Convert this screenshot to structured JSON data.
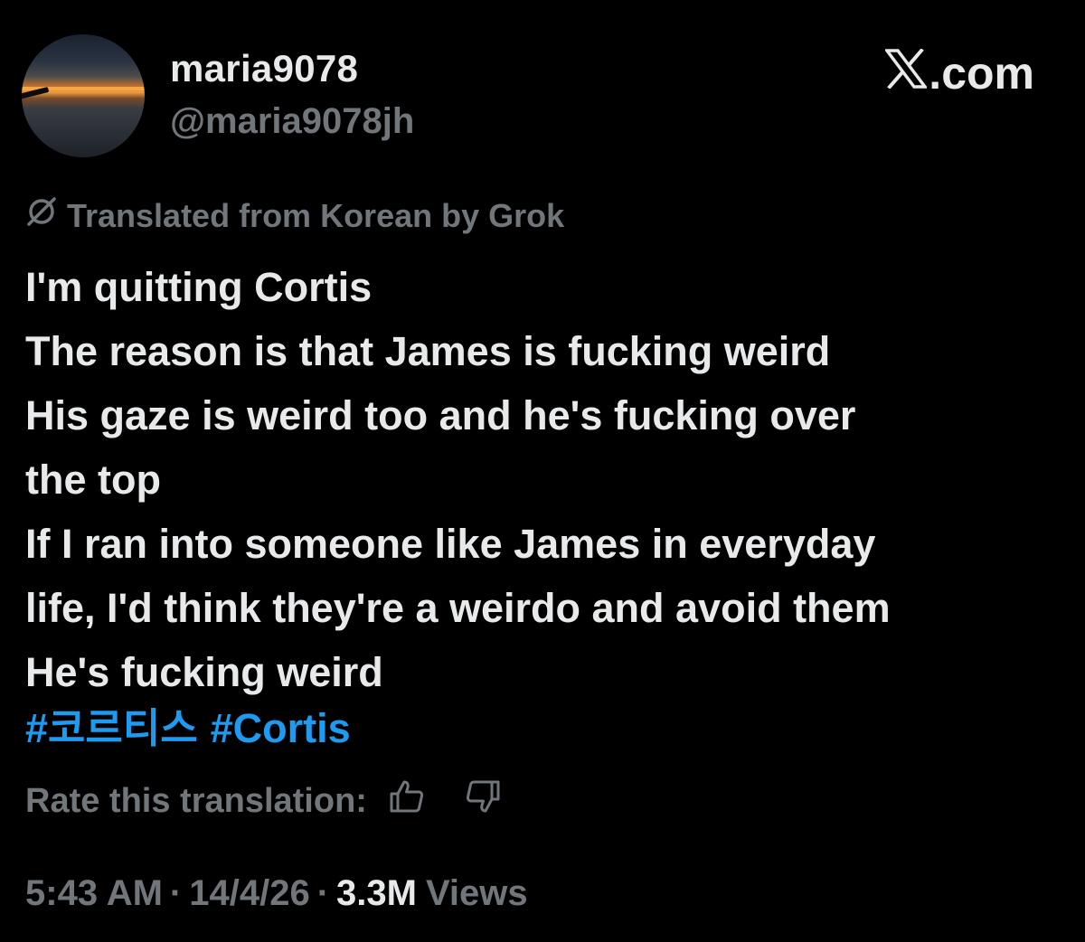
{
  "author": {
    "display_name": "maria9078",
    "handle": "@maria9078jh"
  },
  "brand": {
    "label": ".com"
  },
  "translation_note": "Translated from Korean by Grok",
  "body_lines": [
    "I'm quitting Cortis",
    "The reason is that James is fucking weird",
    "His gaze is weird too and he's fucking over",
    "the top",
    "If I ran into someone like James in everyday",
    "life, I'd think they're a weirdo and avoid them",
    "He's fucking weird"
  ],
  "hashtags": [
    "#코르티스",
    "#Cortis"
  ],
  "rate": {
    "label": "Rate this translation:",
    "thumbs_up_icon": "thumbs-up-icon",
    "thumbs_down_icon": "thumbs-down-icon"
  },
  "meta": {
    "time": "5:43 AM",
    "date": "14/4/26",
    "views_count": "3.3M",
    "views_label": "Views",
    "separator": "·"
  },
  "colors": {
    "background": "#000000",
    "primary_text": "#e7e9ea",
    "secondary_text": "#71767b",
    "link": "#1d9bf0"
  }
}
